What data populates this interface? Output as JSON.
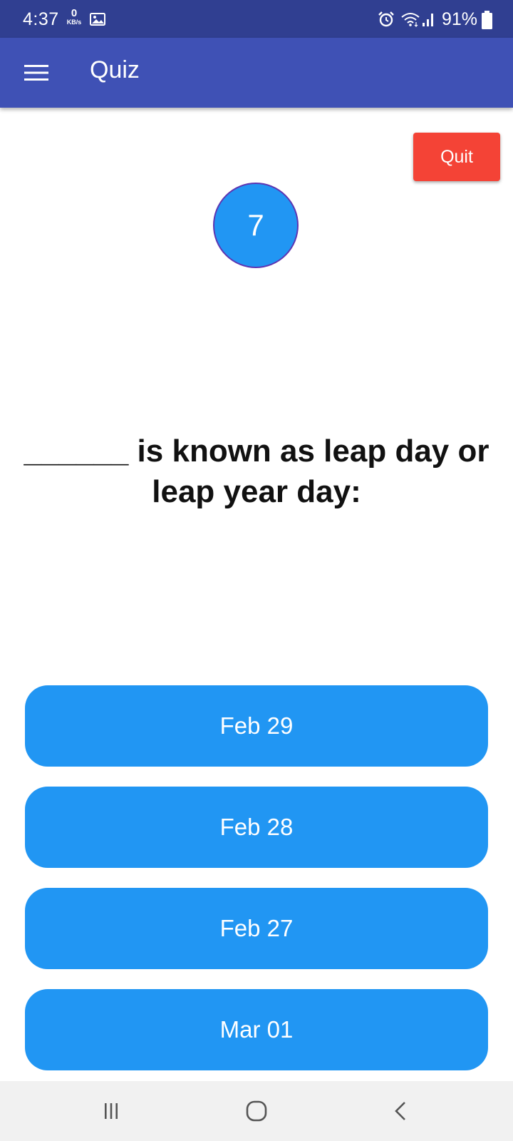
{
  "status_bar": {
    "time": "4:37",
    "network_speed_value": "0",
    "network_speed_unit": "KB/s",
    "battery_percent": "91%",
    "icons": [
      "image-icon",
      "alarm-icon",
      "wifi-icon",
      "signal-icon",
      "battery-icon"
    ]
  },
  "app_bar": {
    "title": "Quiz",
    "menu_icon": "hamburger-menu-icon",
    "background_color": "#3f51b5"
  },
  "quiz": {
    "quit_label": "Quit",
    "timer_value": "7",
    "question": "______ is known as leap day or leap year day:",
    "answers": [
      {
        "label": "Feb 29"
      },
      {
        "label": "Feb 28"
      },
      {
        "label": "Feb 27"
      },
      {
        "label": "Mar 01"
      }
    ]
  },
  "colors": {
    "status_bar": "#303f91",
    "accent": "#2196f3",
    "quit": "#f44336",
    "nav_bar": "#f1f1f1"
  },
  "nav_bar": {
    "icons": [
      "recents-icon",
      "home-icon",
      "back-icon"
    ]
  }
}
